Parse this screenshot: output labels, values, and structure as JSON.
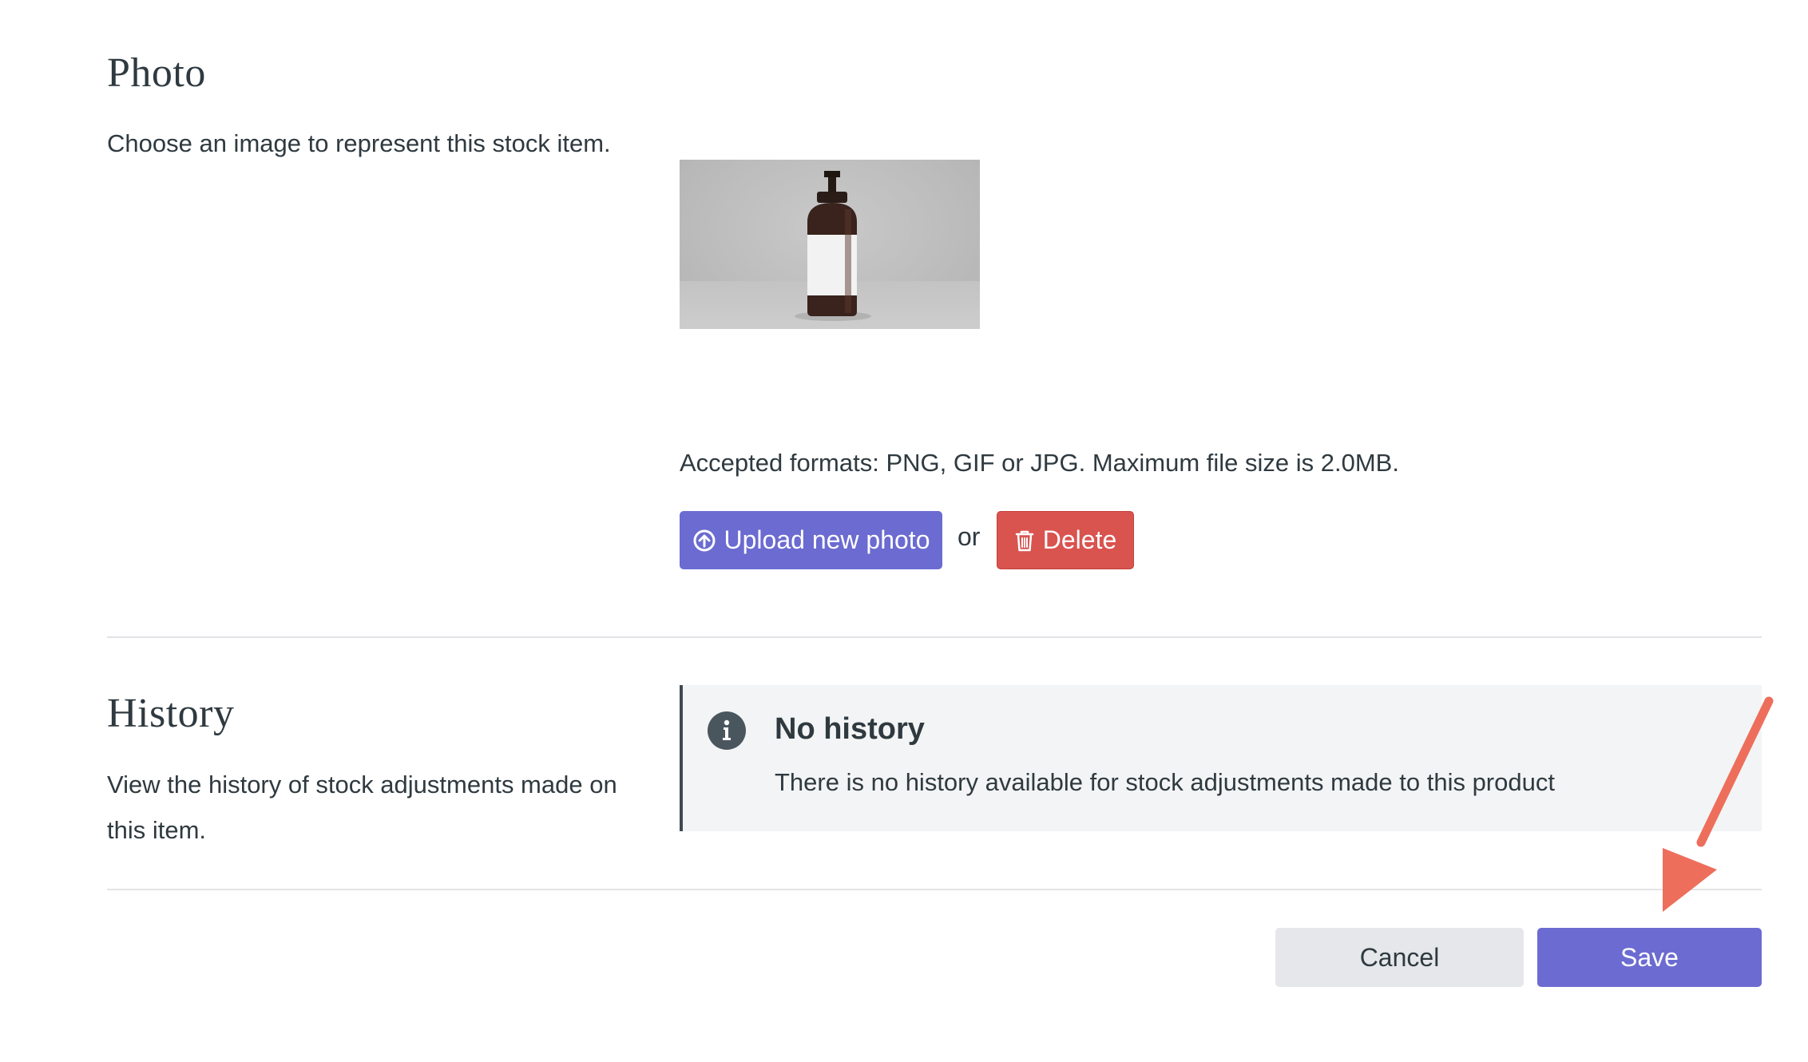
{
  "photo": {
    "title": "Photo",
    "description": "Choose an image to represent this stock item.",
    "accepted_formats": "Accepted formats: PNG, GIF or JPG. Maximum file size is 2.0MB.",
    "upload_label": "Upload new photo",
    "or_text": "or",
    "delete_label": "Delete"
  },
  "history": {
    "title": "History",
    "description": "View the history of stock adjustments made on this item.",
    "notice_title": "No history",
    "notice_body": "There is no history available for stock adjustments made to this product"
  },
  "footer": {
    "cancel_label": "Cancel",
    "save_label": "Save"
  },
  "colors": {
    "primary": "#6b6bd1",
    "danger": "#d9534f",
    "annotation_arrow": "#ee6e5c",
    "text": "#2f3a40"
  },
  "icons": {
    "upload": "upload-circle-icon",
    "delete": "trash-icon",
    "info": "info-icon",
    "annotation": "arrow-annotation-icon"
  }
}
